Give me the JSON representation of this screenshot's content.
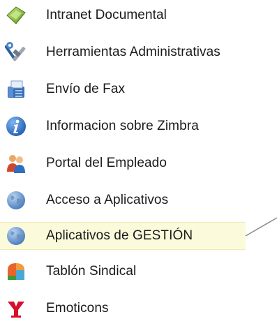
{
  "menu": {
    "items": [
      {
        "label": "Intranet Documental",
        "icon": "document-intranet-icon"
      },
      {
        "label": "Herramientas Administrativas",
        "icon": "admin-tools-icon"
      },
      {
        "label": "Envío de Fax",
        "icon": "fax-machine-icon"
      },
      {
        "label": "Informacion sobre Zimbra",
        "icon": "info-icon"
      },
      {
        "label": "Portal del Empleado",
        "icon": "employees-icon"
      },
      {
        "label": "Acceso a Aplicativos",
        "icon": "globe-icon"
      },
      {
        "label": "Aplicativos de GESTIÓN",
        "icon": "globe-icon"
      },
      {
        "label": "Tablón Sindical",
        "icon": "bulletin-board-icon"
      },
      {
        "label": "Emoticons",
        "icon": "yahoo-y-icon"
      }
    ],
    "highlighted_index": 6
  },
  "colors": {
    "highlight_bg": "#fbfbdc",
    "highlight_border": "#ebebb8",
    "text": "#1a1a1a"
  }
}
